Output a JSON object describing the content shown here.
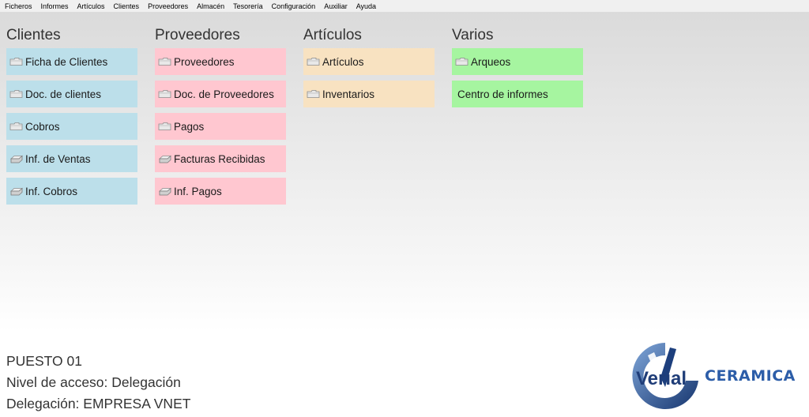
{
  "menu": [
    "Ficheros",
    "Informes",
    "Artículos",
    "Clientes",
    "Proveedores",
    "Almacén",
    "Tesorería",
    "Configuración",
    "Auxiliar",
    "Ayuda"
  ],
  "columns": {
    "clientes": {
      "title": "Clientes",
      "items": [
        "Ficha de Clientes",
        "Doc. de clientes",
        "Cobros",
        "Inf. de Ventas",
        "Inf. Cobros"
      ]
    },
    "proveedores": {
      "title": "Proveedores",
      "items": [
        "Proveedores",
        "Doc. de Proveedores",
        "Pagos",
        "Facturas Recibidas",
        "Inf. Pagos"
      ]
    },
    "articulos": {
      "title": "Artículos",
      "items": [
        "Artículos",
        "Inventarios"
      ]
    },
    "varios": {
      "title": "Varios",
      "items": [
        "Arqueos",
        "Centro de informes"
      ]
    }
  },
  "footer": {
    "puesto": "PUESTO 01",
    "nivel": "Nivel de acceso: Delegación",
    "delegacion": "Delegación: EMPRESA VNET"
  },
  "logo": {
    "wordmark": "Verial",
    "brand": "CERAMICA"
  },
  "colors": {
    "clientes": "#bcdfea",
    "proveedores": "#ffc7d0",
    "articulos": "#f8e2c1",
    "varios": "#a6f5a0",
    "brand": "#2c5da8"
  }
}
